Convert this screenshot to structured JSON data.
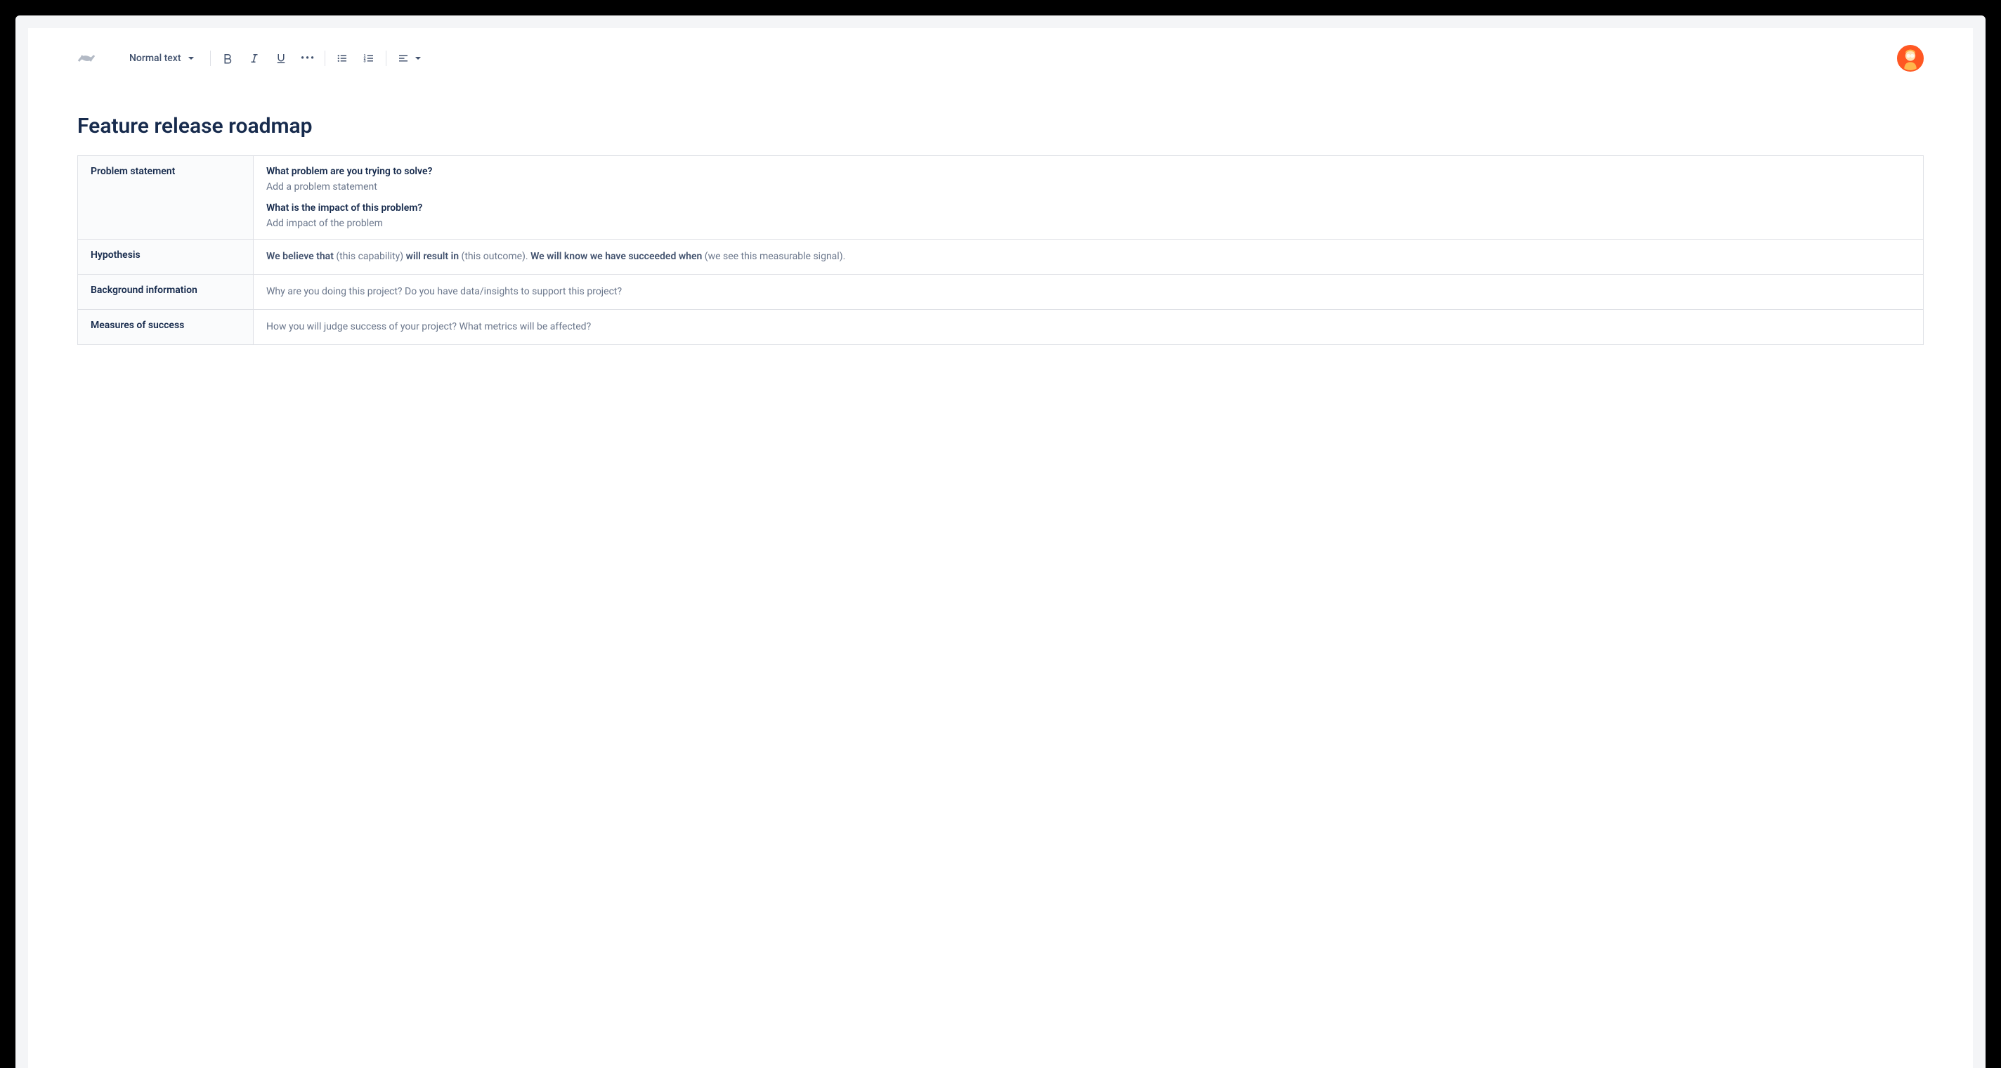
{
  "toolbar": {
    "text_style": "Normal text"
  },
  "page": {
    "title": "Feature release roadmap"
  },
  "rows": {
    "problem": {
      "label": "Problem statement",
      "q1": "What problem are you trying to solve?",
      "p1": "Add a problem statement",
      "q2": "What is the impact of this problem?",
      "p2": "Add impact of the problem"
    },
    "hypothesis": {
      "label": "Hypothesis",
      "b1": "We believe that",
      "t1": " (this capability) ",
      "b2": "will result in",
      "t2": " (this outcome). ",
      "b3": "We will know we have succeeded when",
      "t3": " (we see this measurable signal)."
    },
    "background": {
      "label": "Background information",
      "placeholder": "Why are you doing this project? Do you have data/insights to support this project?"
    },
    "measures": {
      "label": "Measures of success",
      "placeholder": "How you will judge success of your project? What metrics will be affected?"
    }
  }
}
